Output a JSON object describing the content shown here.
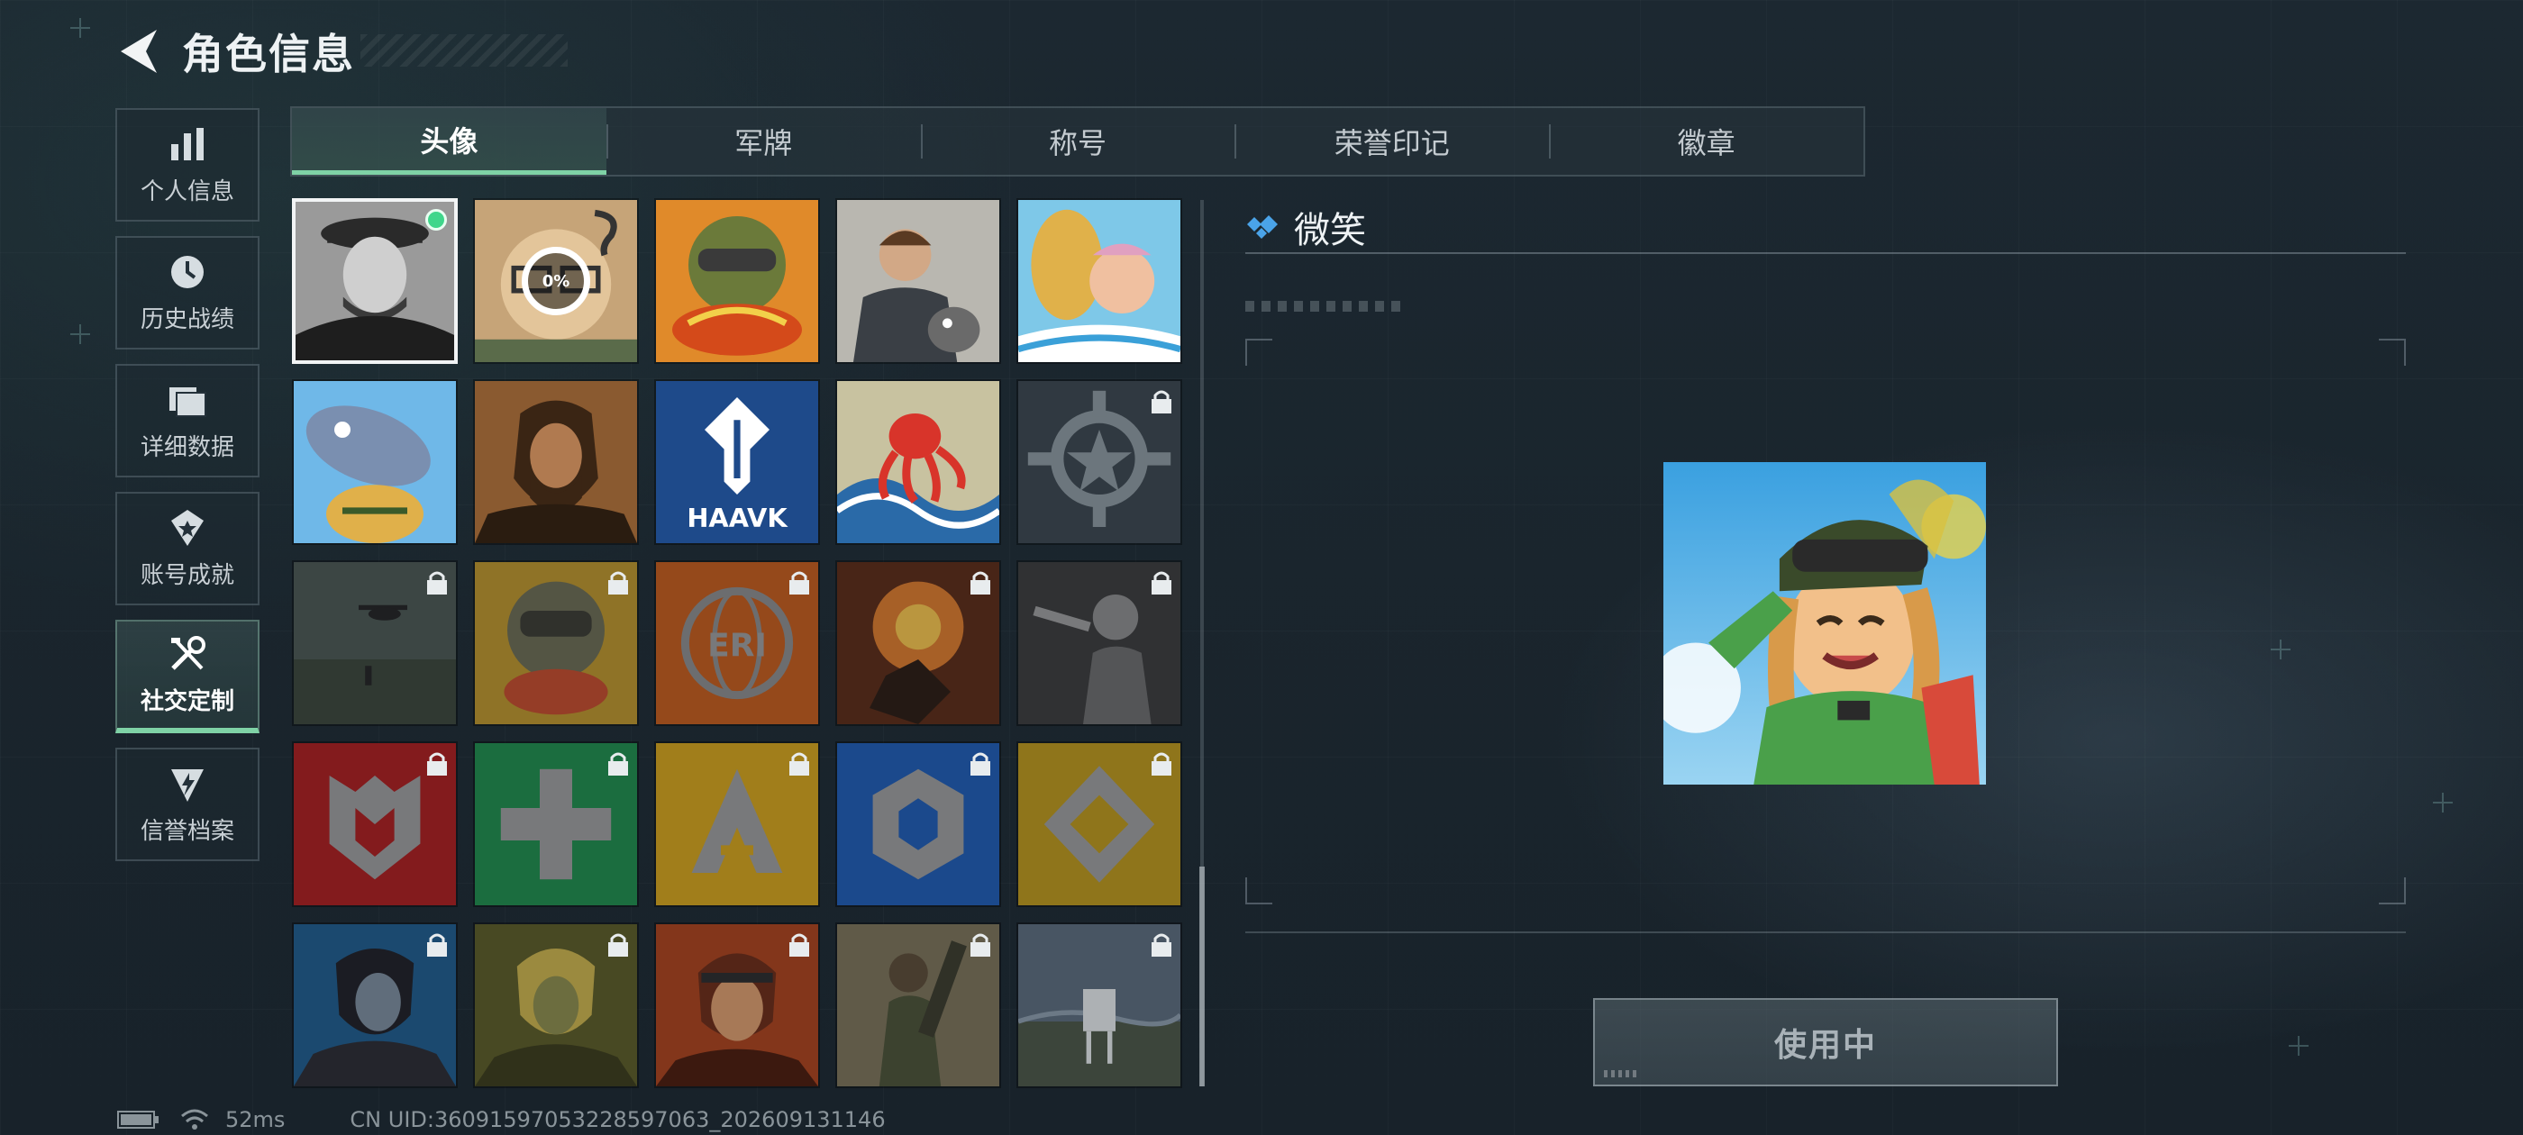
{
  "header": {
    "title": "角色信息"
  },
  "sidebar": {
    "items": [
      {
        "label": "个人信息",
        "icon": "bar-chart-icon",
        "active": false
      },
      {
        "label": "历史战绩",
        "icon": "clock-icon",
        "active": false
      },
      {
        "label": "详细数据",
        "icon": "folder-icon",
        "active": false
      },
      {
        "label": "账号成就",
        "icon": "medal-icon",
        "active": false
      },
      {
        "label": "社交定制",
        "icon": "tools-icon",
        "active": true
      },
      {
        "label": "信誉档案",
        "icon": "shield-bolt-icon",
        "active": false
      }
    ]
  },
  "tabs": [
    {
      "label": "头像",
      "active": true
    },
    {
      "label": "军牌",
      "active": false
    },
    {
      "label": "称号",
      "active": false
    },
    {
      "label": "荣誉印记",
      "active": false
    },
    {
      "label": "徽章",
      "active": false
    }
  ],
  "avatars": [
    {
      "name": "portrait-cap-man",
      "locked": false,
      "selected": true,
      "owned_badge": true
    },
    {
      "name": "cartoon-glasses-progress",
      "locked": false,
      "progress": "0%"
    },
    {
      "name": "cartoon-soldier-noodles",
      "locked": false
    },
    {
      "name": "operator-with-dog",
      "locked": false
    },
    {
      "name": "cartoon-fishing",
      "locked": false
    },
    {
      "name": "cartoon-fish",
      "locked": false
    },
    {
      "name": "bearded-man",
      "locked": false
    },
    {
      "name": "haavk-logo",
      "locked": false,
      "text": "HAAVK"
    },
    {
      "name": "octopus-wave",
      "locked": false
    },
    {
      "name": "star-emblem",
      "locked": true
    },
    {
      "name": "helicopter-field",
      "locked": true
    },
    {
      "name": "cartoon-soldier-eating",
      "locked": true
    },
    {
      "name": "eri-globe",
      "locked": true,
      "text": "ERI"
    },
    {
      "name": "explosion-scene",
      "locked": true
    },
    {
      "name": "soldier-pistol",
      "locked": true
    },
    {
      "name": "red-shield-emblem",
      "locked": true
    },
    {
      "name": "green-cross-emblem",
      "locked": true
    },
    {
      "name": "yellow-a-emblem",
      "locked": true
    },
    {
      "name": "blue-hex-emblem",
      "locked": true
    },
    {
      "name": "gold-diamond-emblem",
      "locked": true
    },
    {
      "name": "dark-hair-man",
      "locked": true
    },
    {
      "name": "blonde-man",
      "locked": true
    },
    {
      "name": "headband-man",
      "locked": true
    },
    {
      "name": "soldier-rocket",
      "locked": true
    },
    {
      "name": "chair-landscape",
      "locked": true
    }
  ],
  "detail": {
    "name": "微笑",
    "button_label": "使用中"
  },
  "status": {
    "ping": "52ms",
    "uid": "CN UID:36091597053228597063_202609131146"
  },
  "colors": {
    "accent": "#7fd2a6",
    "owned_dot": "#3fd68b",
    "diamond": "#4aa3e8"
  }
}
